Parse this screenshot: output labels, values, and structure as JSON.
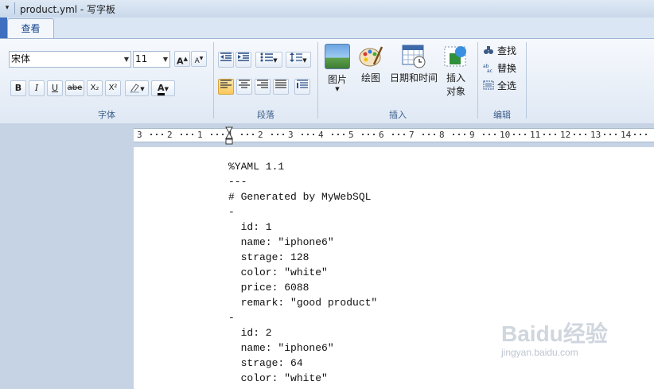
{
  "window": {
    "title": "product.yml - 写字板"
  },
  "tabs": {
    "view": "查看"
  },
  "font_group": {
    "label": "字体",
    "font_name": "宋体",
    "font_size": "11",
    "grow": "A",
    "shrink": "A",
    "bold": "B",
    "italic": "I",
    "underline": "U",
    "strike": "abe",
    "subscript": "X₂",
    "superscript": "X²",
    "color_letter": "A"
  },
  "paragraph_group": {
    "label": "段落"
  },
  "insert_group": {
    "label": "插入",
    "picture": "图片",
    "paint": "绘图",
    "datetime": "日期和时间",
    "insert_object_1": "插入",
    "insert_object_2": "对象"
  },
  "edit_group": {
    "label": "编辑",
    "find": "查找",
    "replace": "替换",
    "select_all": "全选"
  },
  "ruler": {
    "numbers": [
      "3",
      "2",
      "1",
      "1",
      "2",
      "3",
      "4",
      "5",
      "6",
      "7",
      "8",
      "9",
      "10",
      "11",
      "12",
      "13",
      "14"
    ]
  },
  "document": {
    "lines": [
      "%YAML 1.1",
      "---",
      "# Generated by MyWebSQL",
      "-",
      "  id: 1",
      "  name: \"iphone6\"",
      "  strage: 128",
      "  color: \"white\"",
      "  price: 6088",
      "  remark: \"good product\"",
      "-",
      "  id: 2",
      "  name: \"iphone6\"",
      "  strage: 64",
      "  color: \"white\""
    ]
  },
  "watermark": {
    "logo": "Baidu经验",
    "url": "jingyan.baidu.com"
  }
}
